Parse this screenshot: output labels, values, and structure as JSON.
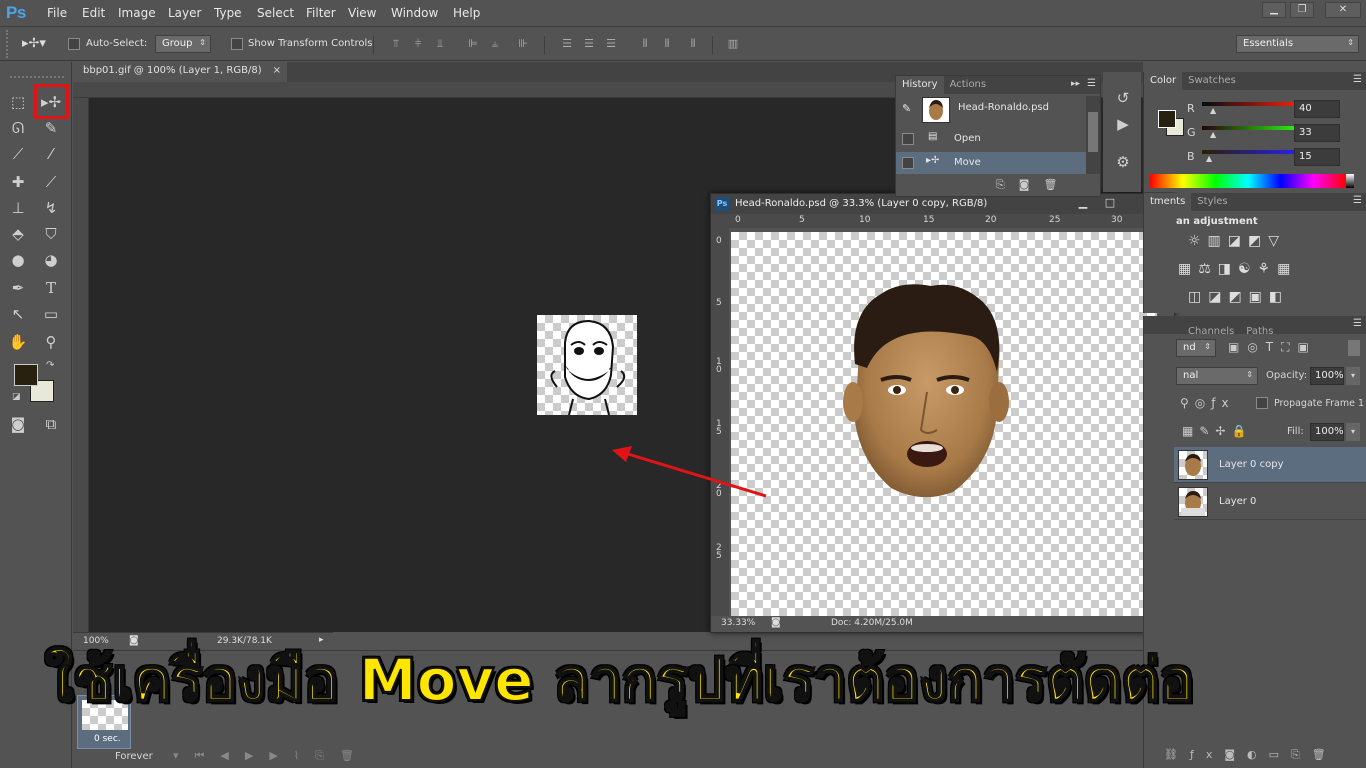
{
  "app": {
    "logo": "Ps"
  },
  "menu": [
    "File",
    "Edit",
    "Image",
    "Layer",
    "Type",
    "Select",
    "Filter",
    "View",
    "Window",
    "Help"
  ],
  "options": {
    "auto_select_label": "Auto-Select:",
    "auto_select_value": "Group",
    "show_transform_label": "Show Transform Controls",
    "workspace": "Essentials"
  },
  "document": {
    "tab_title": "bbp01.gif @ 100% (Layer 1, RGB/8)",
    "zoom": "100%",
    "doc_info": "29.3K/78.1K"
  },
  "psd_window": {
    "title": "Head-Ronaldo.psd @ 33.3% (Layer 0 copy, RGB/8)",
    "ruler_x": [
      "0",
      "5",
      "10",
      "15",
      "20",
      "25",
      "30"
    ],
    "ruler_y": [
      "0",
      "5",
      "1 0",
      "1 5",
      "2 0",
      "2 5"
    ],
    "zoom": "33.33%",
    "doc_info": "Doc: 4.20M/25.0M"
  },
  "history": {
    "tabs": [
      "History",
      "Actions"
    ],
    "snapshot": "Head-Ronaldo.psd",
    "states": [
      "Open",
      "Move"
    ]
  },
  "color": {
    "tabs": [
      "Color",
      "Swatches"
    ],
    "r_label": "R",
    "r": "40",
    "g_label": "G",
    "g": "33",
    "b_label": "B",
    "b": "15",
    "foreground": "#28210f"
  },
  "adjustments": {
    "tabs": [
      "tments",
      "Styles"
    ],
    "heading": "an adjustment"
  },
  "layers": {
    "tabs": [
      "Channels",
      "Paths"
    ],
    "kind_partial": "nd",
    "blend_partial": "nal",
    "opacity_label": "Opacity:",
    "opacity": "100%",
    "propagate_label": "Propagate Frame 1",
    "fill_label": "Fill:",
    "fill": "100%",
    "items": [
      {
        "name": "Layer 0 copy",
        "selected": true
      },
      {
        "name": "Layer 0",
        "selected": false
      }
    ]
  },
  "timeline": {
    "frame_delay": "0 sec.",
    "loop": "Forever"
  },
  "caption": "ใช้เครื่องมือ Move ลากรูปที่เราต้องการตัดต่อ",
  "colors": {
    "highlight": "#e01414",
    "caption": "#ffe600",
    "arrow": "#e01414"
  }
}
